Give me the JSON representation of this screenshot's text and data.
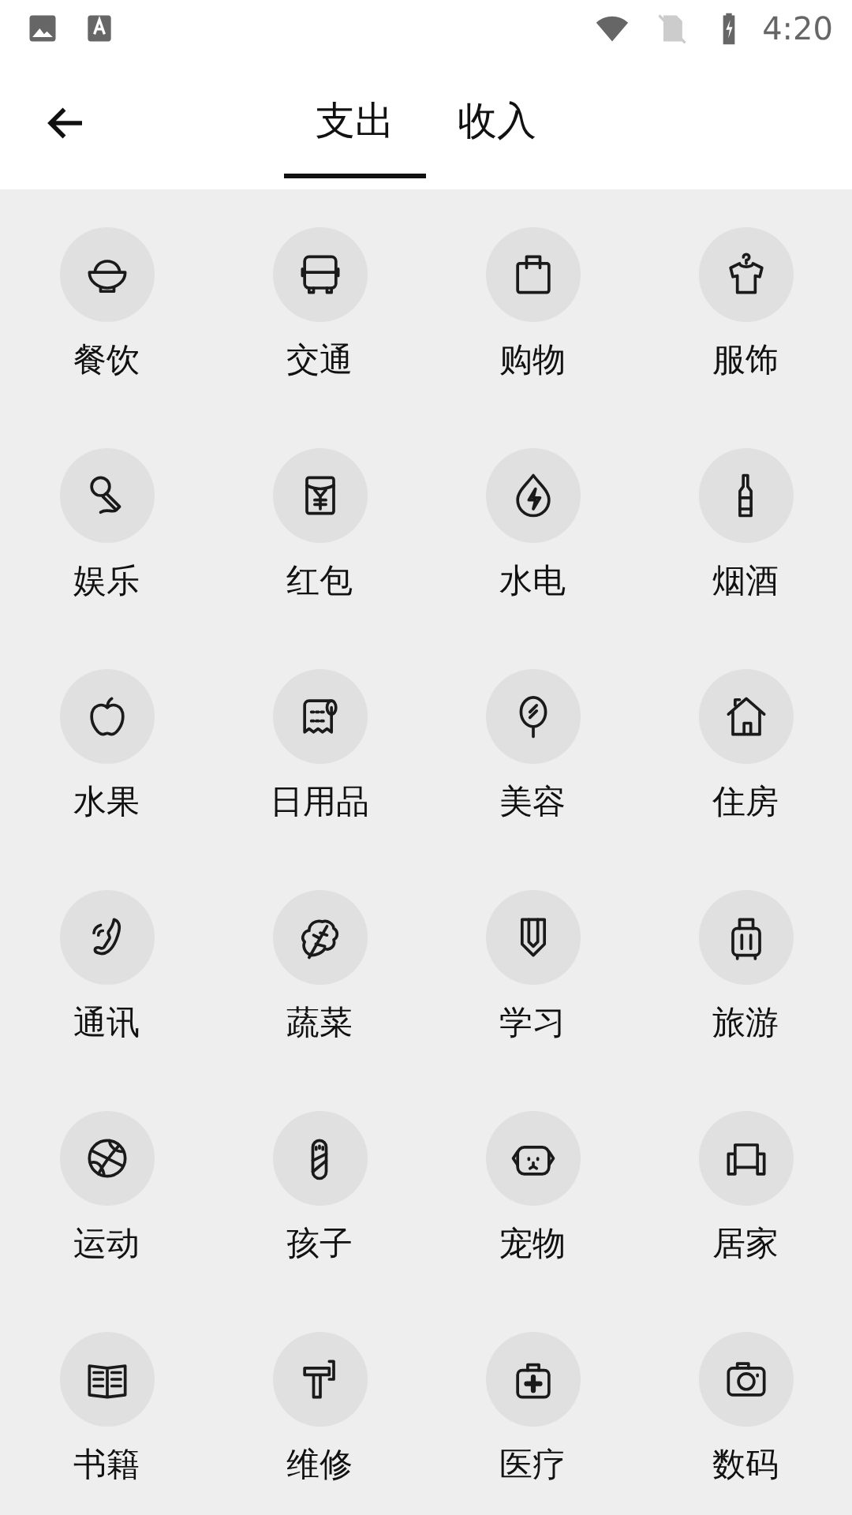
{
  "status_bar": {
    "time": "4:20"
  },
  "tabs": [
    {
      "label": "支出",
      "selected": true
    },
    {
      "label": "收入",
      "selected": false
    }
  ],
  "categories": [
    {
      "label": "餐饮"
    },
    {
      "label": "交通"
    },
    {
      "label": "购物"
    },
    {
      "label": "服饰"
    },
    {
      "label": "娱乐"
    },
    {
      "label": "红包"
    },
    {
      "label": "水电"
    },
    {
      "label": "烟酒"
    },
    {
      "label": "水果"
    },
    {
      "label": "日用品"
    },
    {
      "label": "美容"
    },
    {
      "label": "住房"
    },
    {
      "label": "通讯"
    },
    {
      "label": "蔬菜"
    },
    {
      "label": "学习"
    },
    {
      "label": "旅游"
    },
    {
      "label": "运动"
    },
    {
      "label": "孩子"
    },
    {
      "label": "宠物"
    },
    {
      "label": "居家"
    },
    {
      "label": "书籍"
    },
    {
      "label": "维修"
    },
    {
      "label": "医疗"
    },
    {
      "label": "数码"
    }
  ]
}
